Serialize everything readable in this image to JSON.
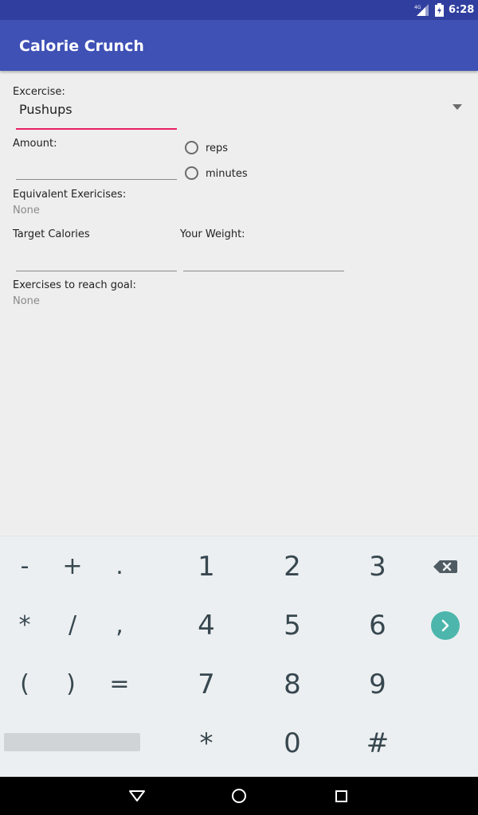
{
  "status_bar": {
    "network": "4G",
    "time": "6:28"
  },
  "app": {
    "title": "Calorie Crunch"
  },
  "form": {
    "exercise_label": "Excercise:",
    "exercise_value": "Pushups",
    "amount_label": "Amount:",
    "amount_value": "",
    "unit_options": [
      "reps",
      "minutes"
    ],
    "equivalent_label": "Equivalent Exericises:",
    "equivalent_value": "None",
    "target_calories_label": "Target Calories",
    "target_calories_value": "",
    "weight_label": "Your Weight:",
    "weight_value": "",
    "goal_label": "Exercises to reach goal:",
    "goal_value": "None"
  },
  "keyboard": {
    "rows": [
      [
        "-",
        "+",
        ".",
        "1",
        "2",
        "3"
      ],
      [
        "*",
        "/",
        ",",
        "4",
        "5",
        "6"
      ],
      [
        "(",
        ")",
        "=",
        "7",
        "8",
        "9"
      ],
      [
        "*",
        "0",
        "#"
      ]
    ],
    "backspace_icon": "backspace-icon",
    "enter_icon": "chevron-right-icon"
  },
  "colors": {
    "primary": "#3f51b5",
    "primary_dark": "#303f9f",
    "accent": "#e91e63",
    "keyboard_action": "#4db6ac"
  },
  "navigation": {
    "back_icon": "back-triangle-icon",
    "home_icon": "home-circle-icon",
    "recents_icon": "recents-square-icon"
  }
}
